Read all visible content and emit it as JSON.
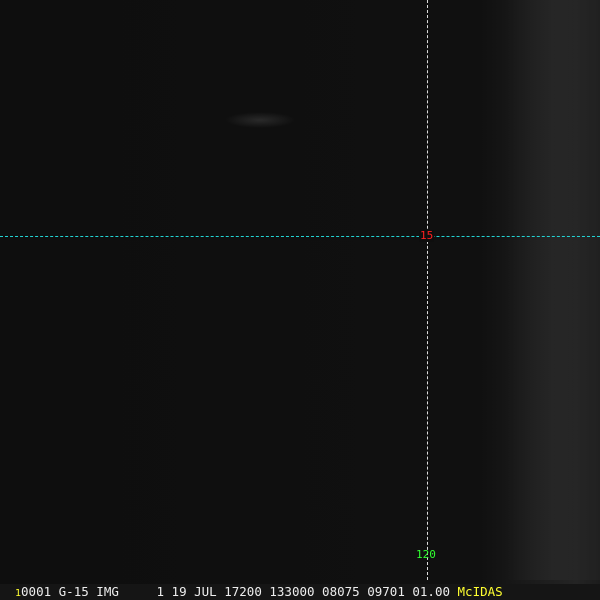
{
  "image": {
    "lat_label": "15",
    "lon_label": "120",
    "colors": {
      "lat_line": "#22d3d3",
      "lon_line": "#dddddd",
      "lat_label": "#ff2020",
      "lon_label": "#30ff30",
      "brand": "#ffff30"
    }
  },
  "status_bar": {
    "frame": "1",
    "info": "0001 G-15 IMG     1 19 JUL 17200 133000 08075 09701 01.00",
    "brand": "McIDAS"
  }
}
